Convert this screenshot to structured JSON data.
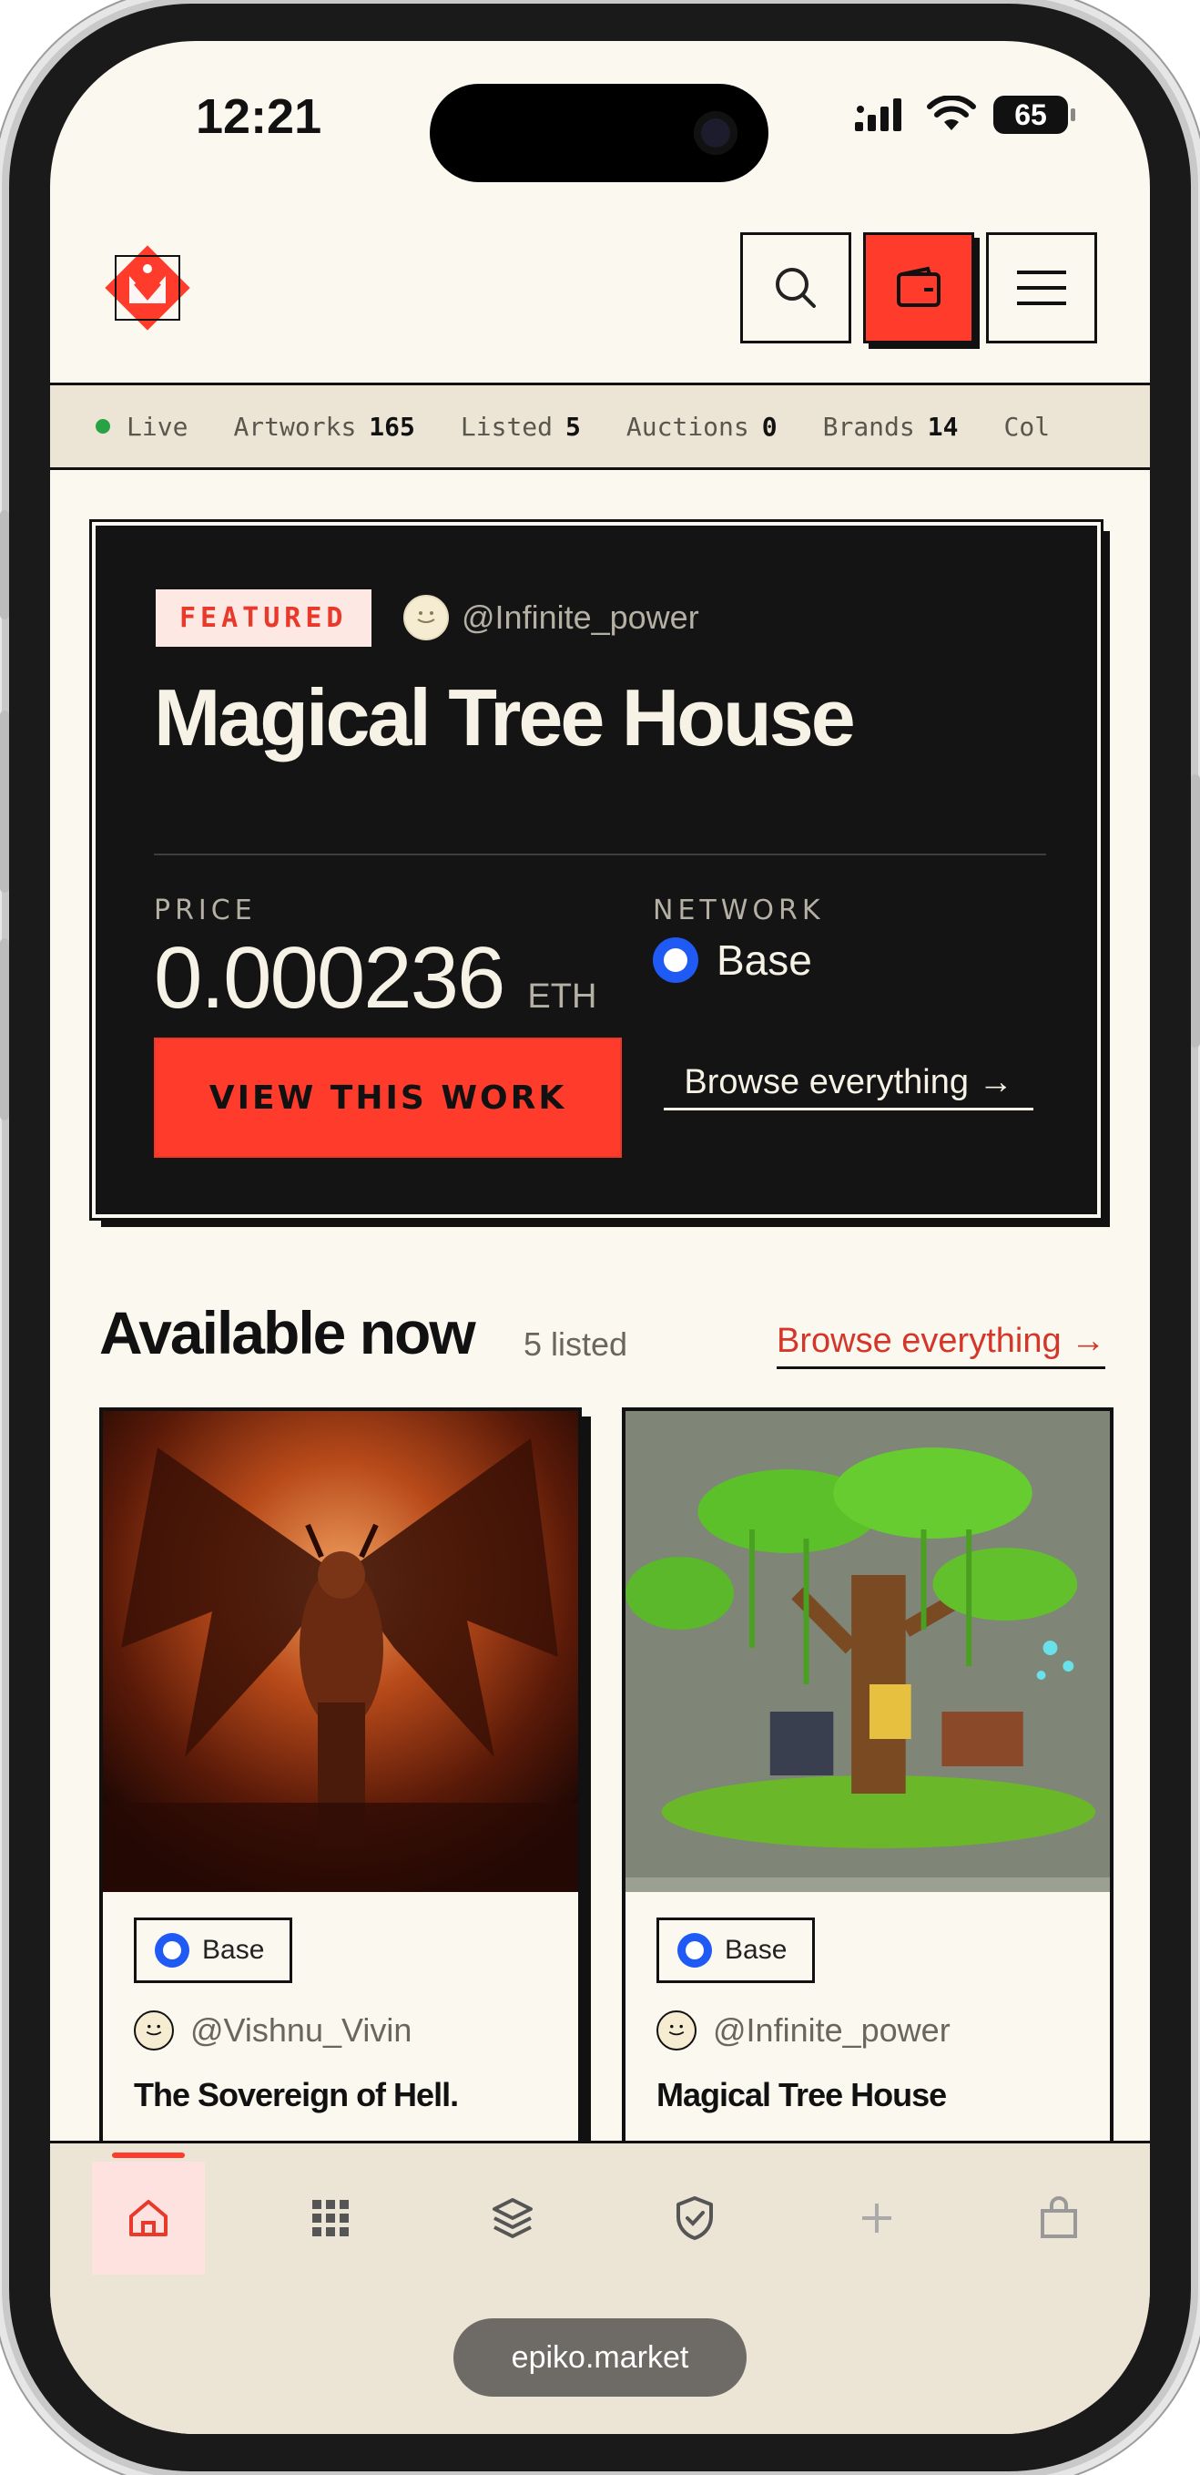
{
  "status_bar": {
    "time": "12:21",
    "battery": "65"
  },
  "header": {
    "logo_icon": "epiko-logo-icon",
    "search_icon": "search-icon",
    "wallet_icon": "wallet-icon",
    "menu_icon": "hamburger-menu-icon"
  },
  "ticker": {
    "live_label": "Live",
    "items": [
      {
        "label": "Artworks",
        "value": "165"
      },
      {
        "label": "Listed",
        "value": "5"
      },
      {
        "label": "Auctions",
        "value": "0"
      },
      {
        "label": "Brands",
        "value": "14"
      },
      {
        "label": "Col",
        "value": ""
      }
    ]
  },
  "featured": {
    "badge": "FEATURED",
    "creator": "@Infinite_power",
    "title": "Magical Tree House",
    "price_label": "PRICE",
    "price_value": "0.000236",
    "price_unit": "ETH",
    "network_label": "NETWORK",
    "network_value": "Base",
    "cta_label": "VIEW THIS WORK",
    "browse_label": "Browse everything →"
  },
  "available": {
    "title": "Available now",
    "count": "5 listed",
    "browse_label": "Browse everything →",
    "cards": [
      {
        "network": "Base",
        "creator": "@Vishnu_Vivin",
        "title": "The Sovereign of Hell."
      },
      {
        "network": "Base",
        "creator": "@Infinite_power",
        "title": "Magical Tree House"
      }
    ]
  },
  "bottom_nav": {
    "items": [
      "home-icon",
      "grid-icon",
      "layers-icon",
      "shield-check-icon",
      "plus-icon",
      "bag-icon"
    ]
  },
  "browser": {
    "url": "epiko.market"
  },
  "colors": {
    "accent": "#ff3b2b",
    "background": "#fbf8ef",
    "dark": "#141414",
    "live_green": "#27a345",
    "base_blue": "#1f5af5"
  }
}
